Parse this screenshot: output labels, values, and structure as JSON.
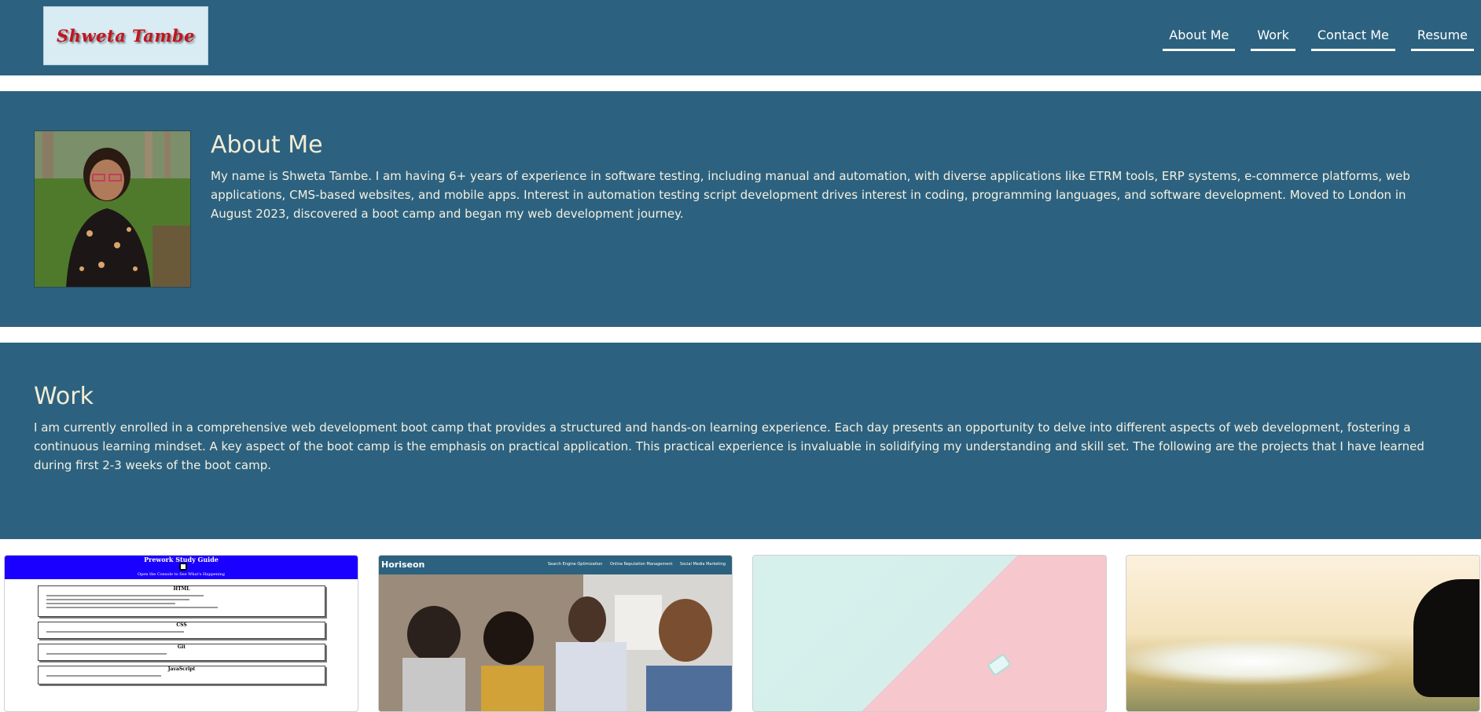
{
  "header": {
    "logo_text": "Shweta Tambe",
    "nav": [
      {
        "label": "About Me"
      },
      {
        "label": "Work"
      },
      {
        "label": "Contact Me"
      },
      {
        "label": "Resume"
      }
    ]
  },
  "about": {
    "title": "About Me",
    "text": "My name is Shweta Tambe. I am having 6+ years of experience in software testing, including manual and automation, with diverse applications like ETRM tools, ERP systems, e-commerce platforms, web applications, CMS-based websites, and mobile apps. Interest in automation testing script development drives interest in coding, programming languages, and software development. Moved to London in August 2023, discovered a boot camp and began my web development journey."
  },
  "work": {
    "title": "Work",
    "text": "I am currently enrolled in a comprehensive web development boot camp that provides a structured and hands-on learning experience. Each day presents an opportunity to delve into different aspects of web development, fostering a continuous learning mindset. A key aspect of the boot camp is the emphasis on practical application. This practical experience is invaluable in solidifying my understanding and skill set. The following are the projects that I have learned during first 2-3 weeks of the boot camp."
  },
  "projects": {
    "prework": {
      "title": "Prework Study Guide",
      "subtitle": "Open the Console to See What's Happening",
      "sections": [
        "HTML",
        "CSS",
        "Git",
        "JavaScript"
      ]
    },
    "horiseon": {
      "brand": "Horiseon",
      "menu": [
        "Search Engine Optimization",
        "Online Reputation Management",
        "Social Media Marketing"
      ]
    }
  },
  "colors": {
    "section_bg": "#2c627f",
    "heading": "#f2ecd6",
    "logo_red": "#c2141f"
  }
}
